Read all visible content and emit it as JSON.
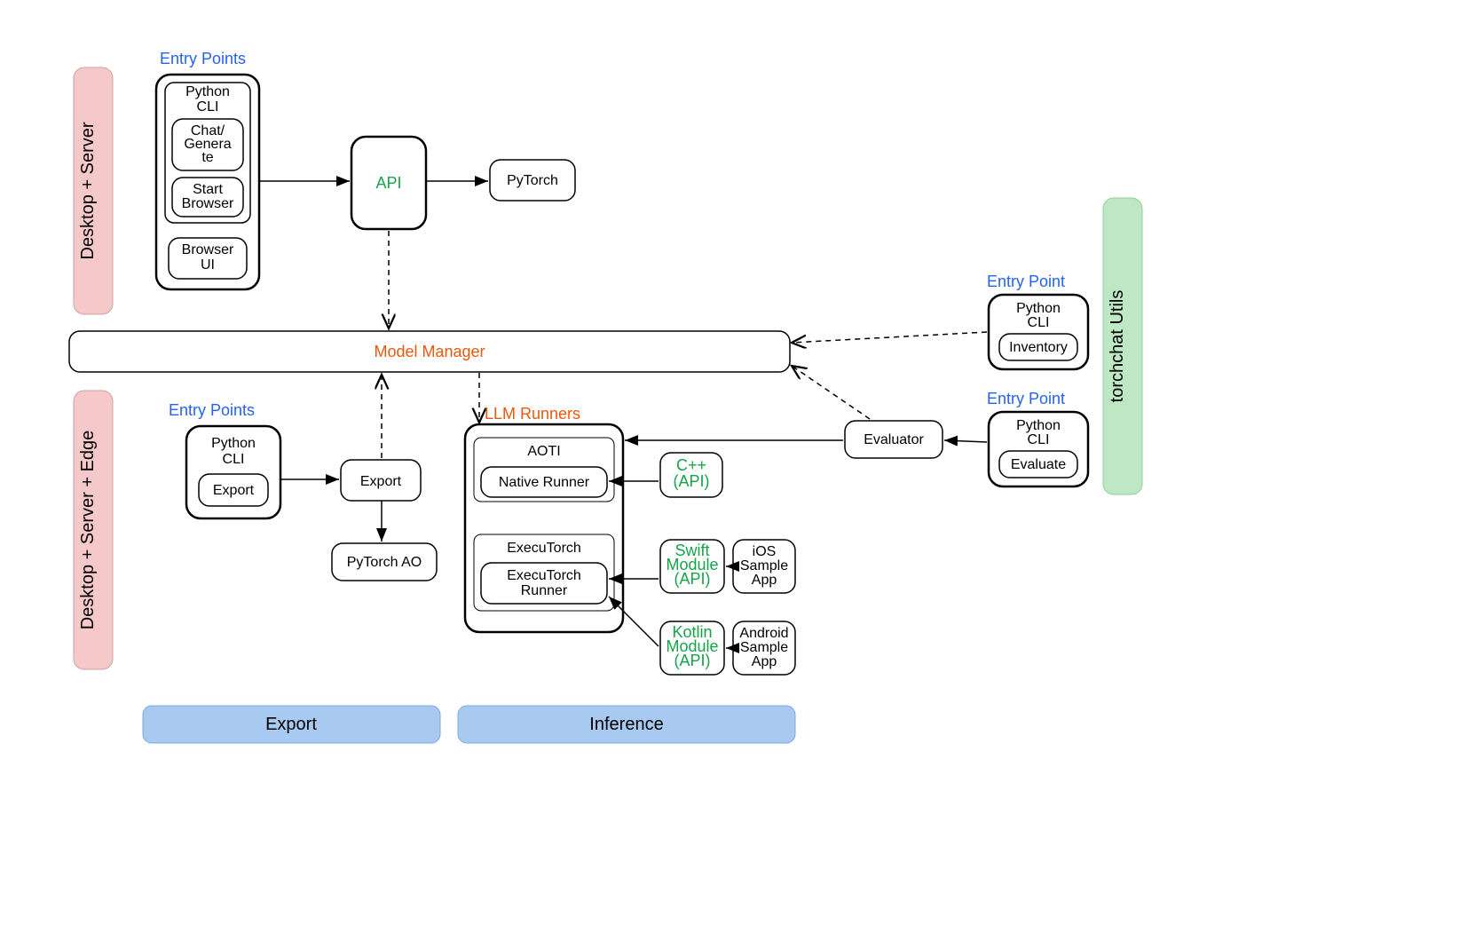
{
  "ribbons": {
    "desktop_server": "Desktop + Server",
    "desktop_server_edge": "Desktop + Server + Edge",
    "torchchat_utils": "torchchat Utils",
    "export": "Export",
    "inference": "Inference"
  },
  "headers": {
    "entry_points_top": "Entry Points",
    "entry_points_left": "Entry Points",
    "entry_point_r1": "Entry Point",
    "entry_point_r2": "Entry Point",
    "llm_runners": "LLM Runners"
  },
  "nodes": {
    "python_cli_top": "Python CLI",
    "chat_generate": "Chat/Generate",
    "start_browser": "Start Browser",
    "browser_ui": "Browser UI",
    "api": "API",
    "pytorch": "PyTorch",
    "model_manager": "Model Manager",
    "python_cli_left": "Python CLI",
    "export_inner": "Export",
    "export_box": "Export",
    "pytorch_ao": "PyTorch AO",
    "aoti": "AOTI",
    "native_runner": "Native Runner",
    "executorch": "ExecuTorch",
    "executorch_runner": "ExecuTorch Runner",
    "cpp_api": "C++ (API)",
    "swift_module": "Swift Module (API)",
    "kotlin_module": "Kotlin Module (API)",
    "ios_sample": "iOS Sample App",
    "android_sample": "Android Sample App",
    "evaluator": "Evaluator",
    "python_cli_r1": "Python CLI",
    "inventory": "Inventory",
    "python_cli_r2": "Python CLI",
    "evaluate": "Evaluate"
  }
}
